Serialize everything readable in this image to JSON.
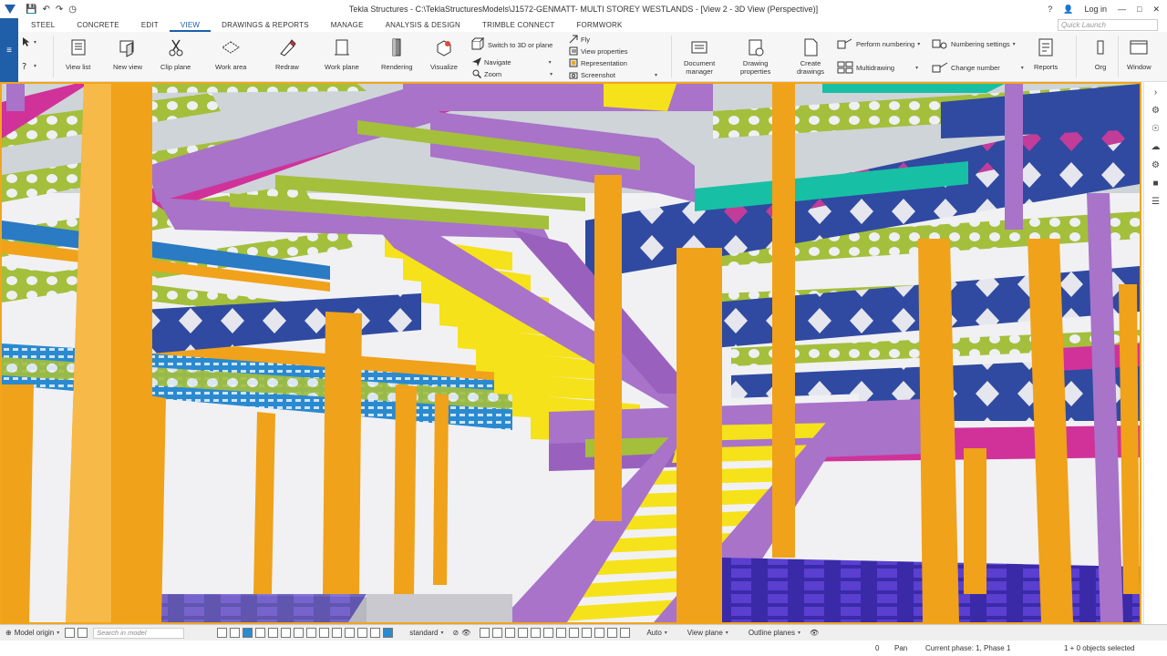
{
  "window": {
    "title": "Tekla Structures - C:\\TeklaStructuresModels\\J1572-GENMATT- MULTI STOREY WESTLANDS  - [View 2 - 3D View (Perspective)]",
    "login": "Log in",
    "quick_launch_placeholder": "Quick Launch"
  },
  "tabs": [
    {
      "label": "STEEL"
    },
    {
      "label": "CONCRETE"
    },
    {
      "label": "EDIT"
    },
    {
      "label": "VIEW",
      "active": true
    },
    {
      "label": "DRAWINGS & REPORTS"
    },
    {
      "label": "MANAGE"
    },
    {
      "label": "ANALYSIS & DESIGN"
    },
    {
      "label": "TRIMBLE CONNECT"
    },
    {
      "label": "FORMWORK"
    }
  ],
  "ribbon": {
    "view_list": "View list",
    "new_view": "New view",
    "clip_plane": "Clip plane",
    "work_area": "Work area",
    "redraw": "Redraw",
    "work_plane": "Work plane",
    "rendering": "Rendering",
    "visualize": "Visualize",
    "switch_3d": "Switch to 3D or plane",
    "navigate": "Navigate",
    "zoom": "Zoom",
    "fly": "Fly",
    "view_properties": "View properties",
    "representation": "Representation",
    "screenshot": "Screenshot",
    "document_manager_1": "Document",
    "document_manager_2": "manager",
    "drawing_properties_1": "Drawing",
    "drawing_properties_2": "properties",
    "create_drawings_1": "Create",
    "create_drawings_2": "drawings",
    "perform_numbering": "Perform numbering",
    "multidrawing": "Multidrawing",
    "numbering_settings": "Numbering settings",
    "change_number": "Change number",
    "reports": "Reports",
    "org": "Org",
    "window": "Window"
  },
  "bottom": {
    "model_origin": "Model origin",
    "search_placeholder": "Search in model",
    "standard": "standard",
    "auto": "Auto",
    "view_plane": "View plane",
    "outline_planes": "Outline planes"
  },
  "status": {
    "zero": "0",
    "pan": "Pan",
    "phase": "Current phase: 1, Phase 1",
    "selected": "1 + 0 objects selected"
  },
  "colors": {
    "accent": "#1a5fa8",
    "viewport_border": "#f2a51b",
    "column_orange": "#f0a21a",
    "beam_magenta": "#d0329a",
    "stair_purple": "#a873c9",
    "tread_yellow": "#f5e21a",
    "cellular_navy": "#2f4aa0",
    "castellated_olive": "#a4bf3c",
    "teal_beam": "#17c0a4"
  }
}
